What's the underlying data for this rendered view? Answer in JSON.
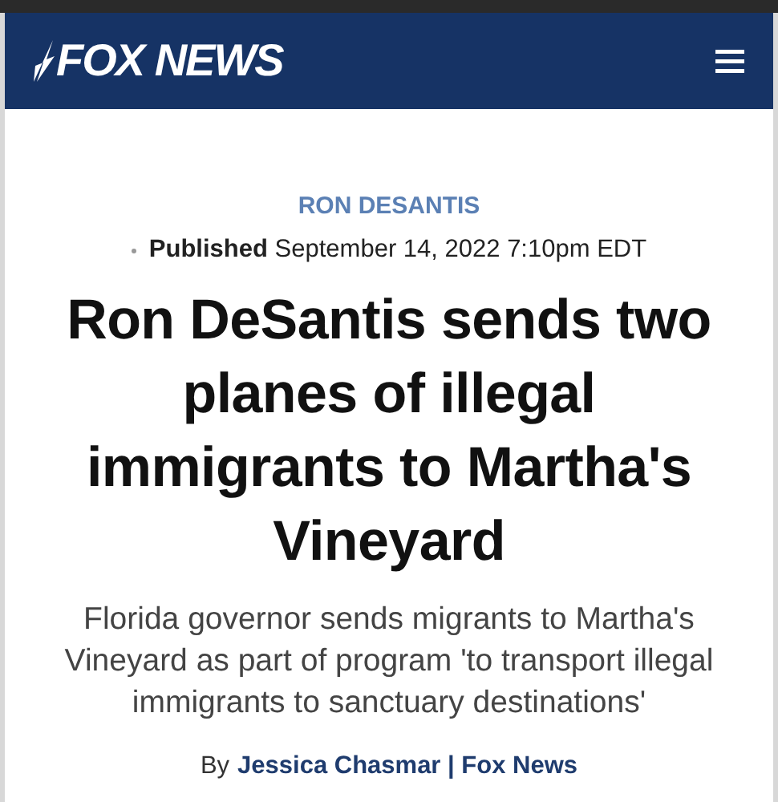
{
  "header": {
    "logo": "FOX NEWS"
  },
  "article": {
    "category": "RON DESANTIS",
    "published": {
      "label": "Published",
      "date": "September 14, 2022 7:10pm EDT"
    },
    "headline": "Ron DeSantis sends two planes of illegal immigrants to Martha's Vineyard",
    "subheadline": "Florida governor sends migrants to Martha's Vineyard as part of program 'to transport illegal immigrants to sanctuary destinations'",
    "byline": {
      "prefix": "By",
      "author": "Jessica Chasmar | Fox News"
    }
  }
}
